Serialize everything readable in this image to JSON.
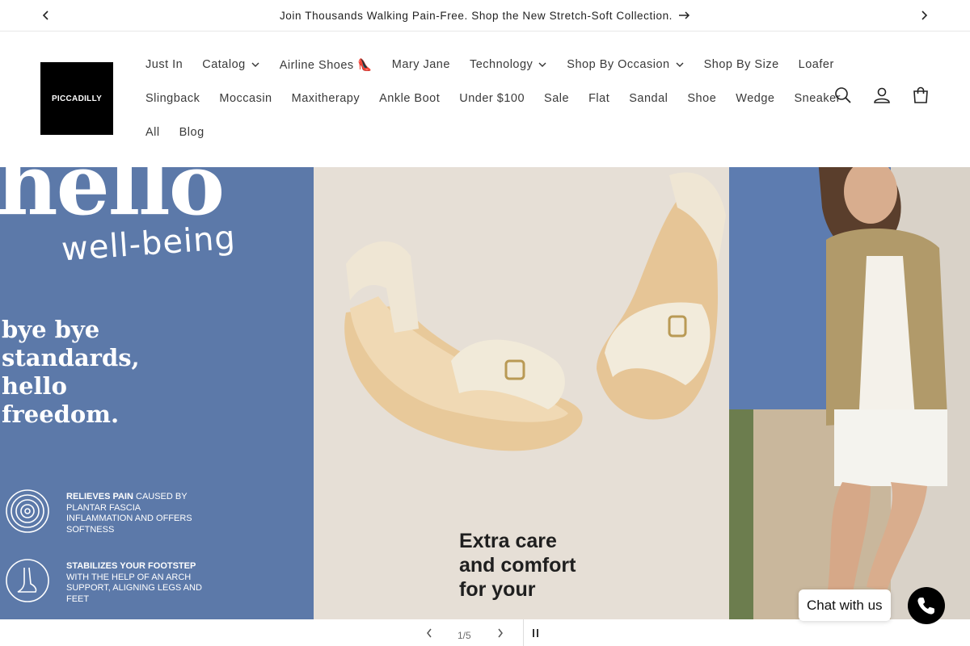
{
  "announcement": {
    "text": "Join Thousands Walking Pain-Free. Shop the New Stretch-Soft Collection."
  },
  "brand": {
    "logo_text": "PICCADILLY"
  },
  "nav": {
    "row1": [
      {
        "label": "Just In",
        "dropdown": false
      },
      {
        "label": "Catalog",
        "dropdown": true
      },
      {
        "label": "Airline Shoes 👠",
        "dropdown": false
      },
      {
        "label": "Mary Jane",
        "dropdown": false
      },
      {
        "label": "Technology",
        "dropdown": true
      },
      {
        "label": "Shop By Occasion",
        "dropdown": true
      },
      {
        "label": "Shop By Size",
        "dropdown": false
      },
      {
        "label": "Loafer",
        "dropdown": false
      }
    ],
    "row2": [
      {
        "label": "Slingback"
      },
      {
        "label": "Moccasin"
      },
      {
        "label": "Maxitherapy"
      },
      {
        "label": "Ankle Boot"
      },
      {
        "label": "Under $100"
      },
      {
        "label": "Sale"
      },
      {
        "label": "Flat"
      },
      {
        "label": "Sandal"
      },
      {
        "label": "Shoe"
      },
      {
        "label": "Wedge"
      },
      {
        "label": "Sneaker"
      }
    ],
    "row3": [
      {
        "label": "All"
      },
      {
        "label": "Blog"
      }
    ]
  },
  "header_icons": [
    "search-icon",
    "account-icon",
    "cart-icon"
  ],
  "hero": {
    "headline": "hello",
    "subheadline": "well-being",
    "tagline": [
      "bye bye",
      "standards,",
      "hello",
      "freedom."
    ],
    "features": [
      {
        "bold": "RELIEVES PAIN",
        "rest": " CAUSED BY PLANTAR FASCIA INFLAMMATION AND OFFERS SOFTNESS"
      },
      {
        "bold": "STABILIZES YOUR FOOTSTEP",
        "rest": " WITH THE HELP OF AN ARCH SUPPORT, ALIGNING LEGS AND FEET"
      }
    ],
    "extra_text": [
      "Extra care",
      "and comfort",
      "for your"
    ],
    "colors": {
      "left_panel": "#5c79a9",
      "mid_panel": "#e6dfd6",
      "right_panel": "#5d7cb0"
    }
  },
  "slideshow": {
    "counter": "1/5"
  },
  "chat": {
    "label": "Chat with us"
  }
}
